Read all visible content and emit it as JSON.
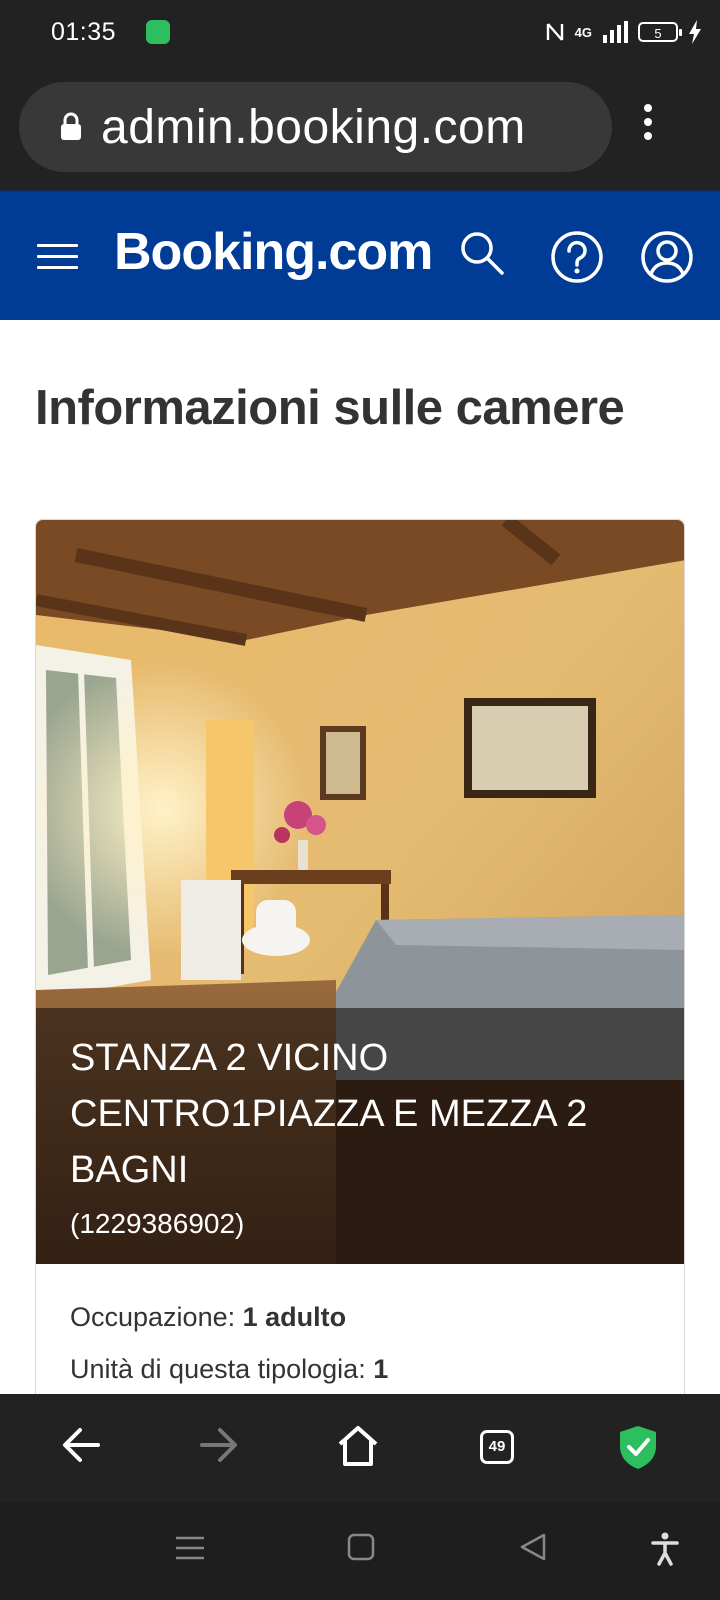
{
  "status": {
    "time": "01:35",
    "network": "4G",
    "battery": "5"
  },
  "browser": {
    "url": "admin.booking.com"
  },
  "header": {
    "logo": "Booking.com"
  },
  "page": {
    "title": "Informazioni sulle camere"
  },
  "room": {
    "name": "STANZA 2 VICINO CENTRO1PIAZZA E MEZZA 2 BAGNI",
    "id": "(1229386902)",
    "occupancy_label": "Occupazione:",
    "occupancy_value": "1 adulto",
    "units_label": "Unità di questa tipologia:",
    "units_value": "1"
  },
  "browser_nav": {
    "tabs_count": "49"
  },
  "colors": {
    "brand_blue": "#003b95",
    "dark_bar": "#222222",
    "shield_green": "#2dbe60"
  },
  "icons": [
    "lock-icon",
    "menu-icon",
    "search-icon",
    "help-icon",
    "account-icon",
    "back-icon",
    "forward-icon",
    "home-icon",
    "tabs-icon",
    "shield-icon",
    "recents-icon",
    "square-icon",
    "triangle-back-icon",
    "accessibility-icon"
  ]
}
